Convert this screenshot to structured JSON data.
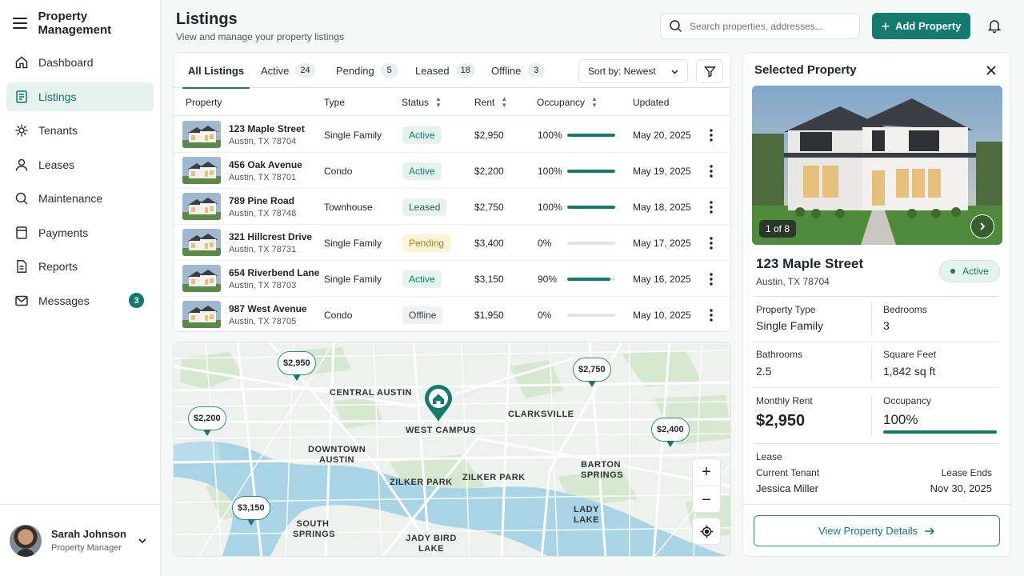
{
  "app": {
    "title": "Property Management"
  },
  "sidebar": {
    "items": [
      {
        "label": "Dashboard",
        "icon": "home-icon"
      },
      {
        "label": "Listings",
        "icon": "list-icon",
        "active": true
      },
      {
        "label": "Tenants",
        "icon": "users-icon"
      },
      {
        "label": "Leases",
        "icon": "user-icon"
      },
      {
        "label": "Maintenance",
        "icon": "search-icon"
      },
      {
        "label": "Payments",
        "icon": "document-icon"
      },
      {
        "label": "Reports",
        "icon": "report-icon"
      },
      {
        "label": "Messages",
        "icon": "mail-icon",
        "badge": "3"
      }
    ]
  },
  "user": {
    "name": "Sarah Johnson",
    "role": "Property Manager"
  },
  "header": {
    "title": "Listings",
    "subtitle": "View and manage your property listings",
    "search_placeholder": "Search properties, addresses...",
    "add_label": "Add Property"
  },
  "tabs": [
    {
      "label": "All Listings",
      "count": ""
    },
    {
      "label": "Active",
      "count": "24"
    },
    {
      "label": "Pending",
      "count": "5"
    },
    {
      "label": "Leased",
      "count": "18"
    },
    {
      "label": "Offline",
      "count": "3"
    }
  ],
  "sort": {
    "label": "Sort by: Newest"
  },
  "table": {
    "columns": [
      "Property",
      "Type",
      "Status",
      "Rent",
      "Occupancy",
      "Updated"
    ],
    "rows": [
      {
        "name": "123 Maple Street",
        "address": "Austin, TX 78704",
        "type": "Single Family",
        "status": "Active",
        "rent": "$2,950",
        "occupancy": "100%",
        "occupancy_value": 1.0,
        "updated": "May 20, 2025"
      },
      {
        "name": "456 Oak Avenue",
        "address": "Austin, TX 78701",
        "type": "Condo",
        "status": "Active",
        "rent": "$2,200",
        "occupancy": "100%",
        "occupancy_value": 1.0,
        "updated": "May 19, 2025"
      },
      {
        "name": "789 Pine Road",
        "address": "Austin, TX 78748",
        "type": "Townhouse",
        "status": "Leased",
        "rent": "$2,750",
        "occupancy": "100%",
        "occupancy_value": 1.0,
        "updated": "May 18, 2025"
      },
      {
        "name": "321 Hillcrest Drive",
        "address": "Austin, TX 78731",
        "type": "Single Family",
        "status": "Pending",
        "rent": "$3,400",
        "occupancy": "0%",
        "occupancy_value": 0.0,
        "updated": "May 17, 2025"
      },
      {
        "name": "654 Riverbend Lane",
        "address": "Austin, TX 78703",
        "type": "Single Family",
        "status": "Active",
        "rent": "$3,150",
        "occupancy": "90%",
        "occupancy_value": 0.9,
        "updated": "May 16, 2025"
      },
      {
        "name": "987 West Avenue",
        "address": "Austin, TX 78705",
        "type": "Condo",
        "status": "Offline",
        "rent": "$1,950",
        "occupancy": "0%",
        "occupancy_value": 0.0,
        "updated": "May 10, 2025"
      }
    ]
  },
  "map": {
    "labels": [
      "CENTRAL AUSTIN",
      "WEST CAMPUS",
      "CLARKSVILLE",
      "DOWNTOWN AUSTIN",
      "ZILKER PARK",
      "ZILKER PARK",
      "BARTON SPRINGS",
      "SOUTH SPRINGS",
      "LADY LAKE",
      "JADY BIRD LAKE"
    ],
    "pins": [
      "$2,950",
      "$2,750",
      "$2,200",
      "$2,400",
      "$3,150"
    ]
  },
  "detail": {
    "header": "Selected Property",
    "photo_counter": "1 of 8",
    "name": "123 Maple Street",
    "address": "Austin, TX 78704",
    "status": "Active",
    "property_type_label": "Property Type",
    "property_type": "Single Family",
    "bedrooms_label": "Bedrooms",
    "bedrooms": "3",
    "bathrooms_label": "Bathrooms",
    "bathrooms": "2.5",
    "sqft_label": "Square Feet",
    "sqft": "1,842 sq ft",
    "rent_label": "Monthly Rent",
    "rent": "$2,950",
    "occupancy_label": "Occupancy",
    "occupancy": "100%",
    "lease_label": "Lease",
    "tenant_label": "Current Tenant",
    "tenant": "Jessica Miller",
    "lease_ends_label": "Lease Ends",
    "lease_ends": "Nov 30, 2025",
    "view_label": "View Property Details"
  },
  "colors": {
    "accent": "#137a6d",
    "accent_light": "#e5f3ef",
    "pending": "#fdf3d7",
    "water": "#a9d4e6",
    "park": "#d6e8cf"
  }
}
